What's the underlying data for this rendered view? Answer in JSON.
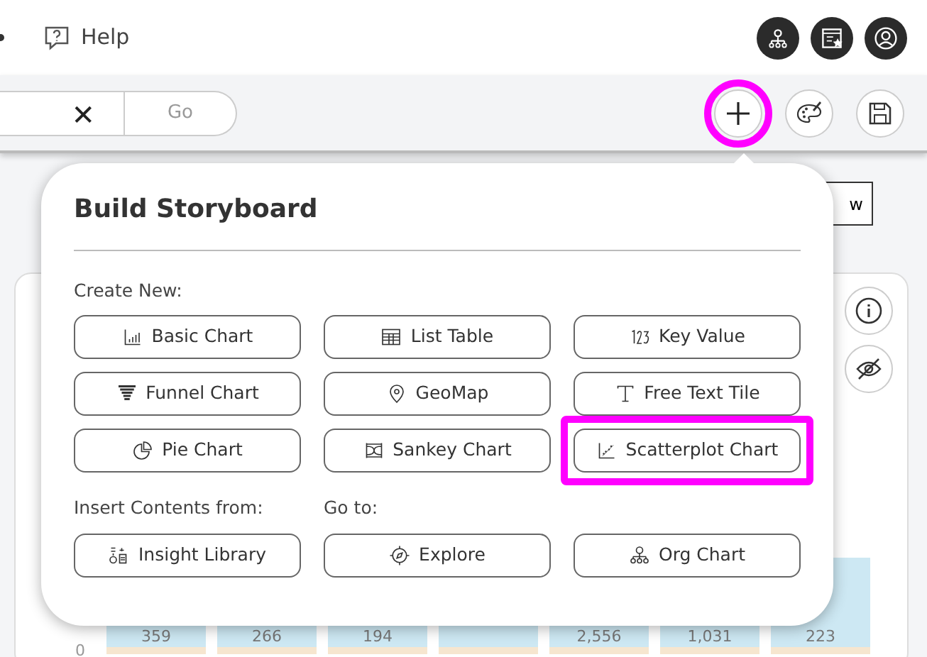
{
  "header": {
    "help_label": "Help",
    "avatar_icons": [
      {
        "kind": "org"
      },
      {
        "kind": "board"
      },
      {
        "kind": "user"
      }
    ]
  },
  "toolbar": {
    "clear_symbol": "✕",
    "go_label": "Go",
    "actions": [
      {
        "kind": "add",
        "highlighted": true
      },
      {
        "kind": "palette",
        "highlighted": false
      },
      {
        "kind": "save",
        "highlighted": false
      }
    ]
  },
  "background": {
    "button_label": "w",
    "axis_label": "0",
    "bars": [
      {
        "label": "359",
        "kind": "short"
      },
      {
        "label": "266",
        "kind": "short"
      },
      {
        "label": "194",
        "kind": "short"
      },
      {
        "kind": "short"
      },
      {
        "label": "2,556",
        "kind": "short"
      },
      {
        "label": "1,031",
        "kind": "low"
      },
      {
        "label": "223",
        "kind": "tall"
      }
    ]
  },
  "popup": {
    "title": "Build Storyboard",
    "create_label": "Create New:",
    "create_buttons": [
      {
        "label": "Basic Chart",
        "kind": "bar",
        "highlighted": false
      },
      {
        "label": "List Table",
        "kind": "table",
        "highlighted": false
      },
      {
        "label": "Key Value",
        "kind": "digits",
        "highlighted": false
      },
      {
        "label": "Funnel Chart",
        "kind": "funnel",
        "highlighted": false
      },
      {
        "label": "GeoMap",
        "kind": "pin",
        "highlighted": false
      },
      {
        "label": "Free Text Tile",
        "kind": "text",
        "highlighted": false
      },
      {
        "label": "Pie Chart",
        "kind": "pie",
        "highlighted": false
      },
      {
        "label": "Sankey Chart",
        "kind": "sankey",
        "highlighted": false
      },
      {
        "label": "Scatterplot Chart",
        "kind": "scatter",
        "highlighted": true
      }
    ],
    "insert_label": "Insert Contents from:",
    "goto_label": "Go to:",
    "bottom_buttons": [
      {
        "label": "Insight Library",
        "kind": "library",
        "highlighted": false
      },
      {
        "label": "Explore",
        "kind": "compass",
        "highlighted": false
      },
      {
        "label": "Org Chart",
        "kind": "org",
        "highlighted": false
      }
    ]
  }
}
